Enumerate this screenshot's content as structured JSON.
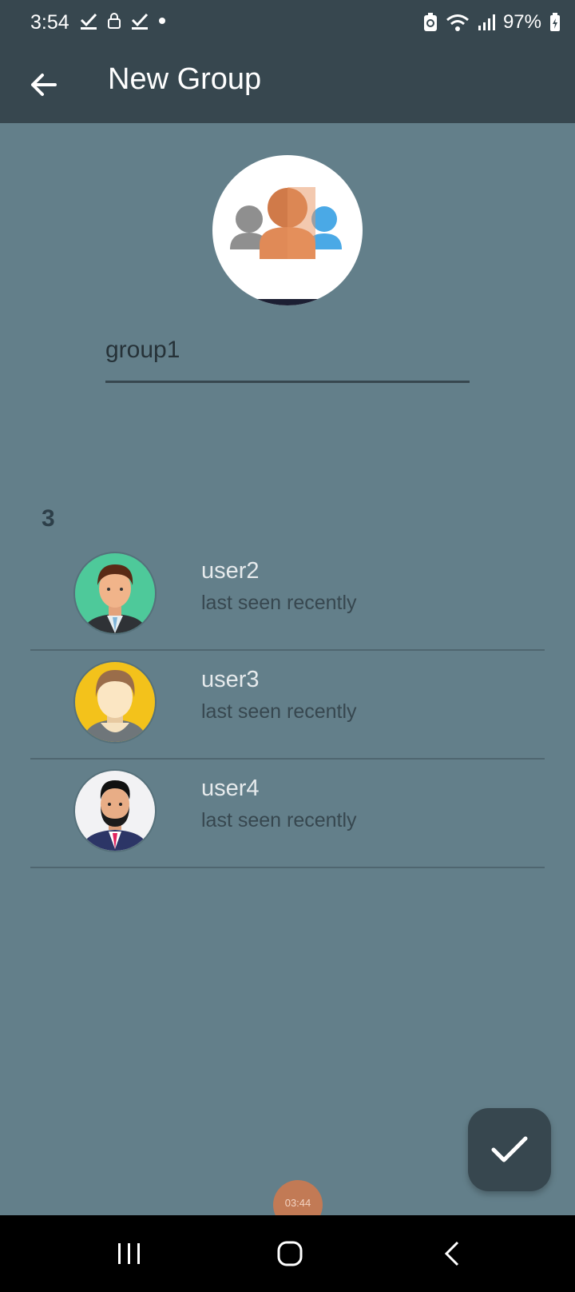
{
  "status_bar": {
    "time": "3:54",
    "battery": "97%",
    "icons_left": [
      "check-download-icon",
      "lock-icon",
      "check-download-icon",
      "dot-icon"
    ],
    "icons_right": [
      "battery-saver-icon",
      "wifi-icon",
      "signal-icon",
      "battery-icon"
    ]
  },
  "app_bar": {
    "title": "New Group",
    "back_icon": "arrow-back-icon"
  },
  "group": {
    "avatar_icon": "group-people-icon",
    "name_value": "group1"
  },
  "members": {
    "count": "3",
    "items": [
      {
        "name": "user2",
        "status": "last seen recently",
        "avatar": "man-suit-green-bg"
      },
      {
        "name": "user3",
        "status": "last seen recently",
        "avatar": "man-yellow-bg"
      },
      {
        "name": "user4",
        "status": "last seen recently",
        "avatar": "bearded-man-white-bg"
      }
    ]
  },
  "fab": {
    "icon": "check-icon"
  },
  "timer": {
    "text": "03:44"
  },
  "nav_bar": {
    "recents_icon": "recents-icon",
    "home_icon": "home-icon",
    "back_icon": "back-icon"
  },
  "colors": {
    "app_bar": "#37474f",
    "background": "#637f8a",
    "fab": "#37474f",
    "accent_orange": "#d9824e"
  }
}
